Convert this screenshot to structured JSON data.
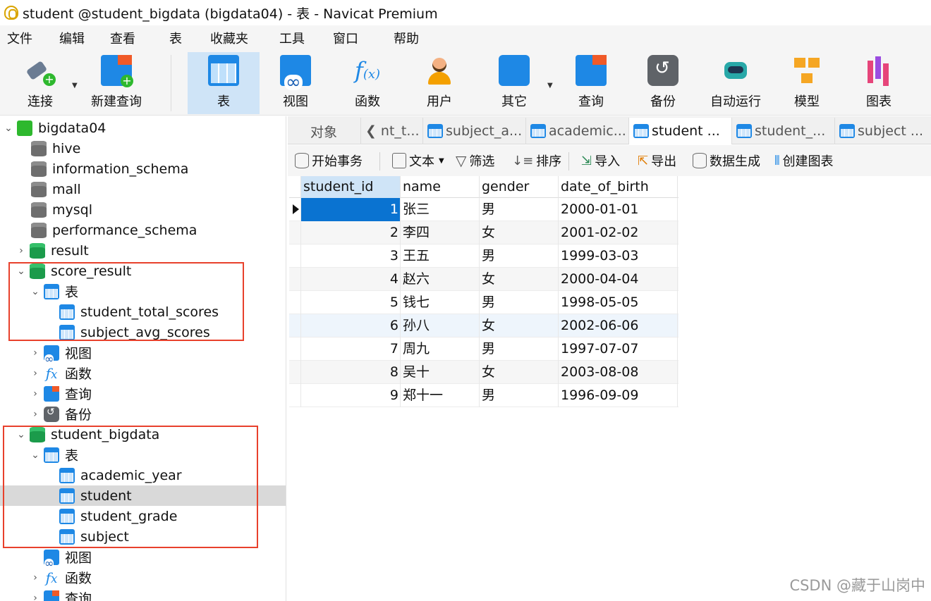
{
  "window": {
    "title": "student @student_bigdata (bigdata04) - 表 - Navicat Premium"
  },
  "menu": [
    "文件",
    "编辑",
    "查看",
    "表",
    "收藏夹",
    "工具",
    "窗口",
    "帮助"
  ],
  "toolbar": {
    "connect": "连接",
    "new_query": "新建查询",
    "table": "表",
    "view": "视图",
    "function": "函数",
    "user": "用户",
    "other": "其它",
    "query": "查询",
    "backup": "备份",
    "automation": "自动运行",
    "model": "模型",
    "chart": "图表"
  },
  "tree": {
    "server": "bigdata04",
    "databases": [
      "hive",
      "information_schema",
      "mall",
      "mysql",
      "performance_schema"
    ],
    "result": "result",
    "score_result": {
      "name": "score_result",
      "tables_label": "表",
      "tables": [
        "student_total_scores",
        "subject_avg_scores"
      ],
      "view": "视图",
      "function": "函数",
      "query": "查询",
      "backup": "备份"
    },
    "student_bigdata": {
      "name": "student_bigdata",
      "tables_label": "表",
      "tables": [
        "academic_year",
        "student",
        "student_grade",
        "subject"
      ],
      "view": "视图",
      "function": "函数",
      "query": "查询"
    }
  },
  "tabs": {
    "objects": "对象",
    "open": [
      "nt_t...",
      "subject_a...",
      "academic...",
      "student ...",
      "student_...",
      "subject ..."
    ]
  },
  "data_toolbar": {
    "begin_transaction": "开始事务",
    "text": "文本",
    "filter": "筛选",
    "sort": "排序",
    "import": "导入",
    "export": "导出",
    "data_generation": "数据生成",
    "create_chart": "创建图表"
  },
  "grid": {
    "columns": [
      "student_id",
      "name",
      "gender",
      "date_of_birth"
    ],
    "rows": [
      [
        "1",
        "张三",
        "男",
        "2000-01-01"
      ],
      [
        "2",
        "李四",
        "女",
        "2001-02-02"
      ],
      [
        "3",
        "王五",
        "男",
        "1999-03-03"
      ],
      [
        "4",
        "赵六",
        "女",
        "2000-04-04"
      ],
      [
        "5",
        "钱七",
        "男",
        "1998-05-05"
      ],
      [
        "6",
        "孙八",
        "女",
        "2002-06-06"
      ],
      [
        "7",
        "周九",
        "男",
        "1997-07-07"
      ],
      [
        "8",
        "吴十",
        "女",
        "2003-08-08"
      ],
      [
        "9",
        "郑十一",
        "男",
        "1996-09-09"
      ]
    ]
  },
  "watermark": "CSDN @藏于山岗中",
  "colors": {
    "accent": "#0a73d1",
    "highlight_box": "#e8412c",
    "active_tab": "#cfe4f7"
  }
}
